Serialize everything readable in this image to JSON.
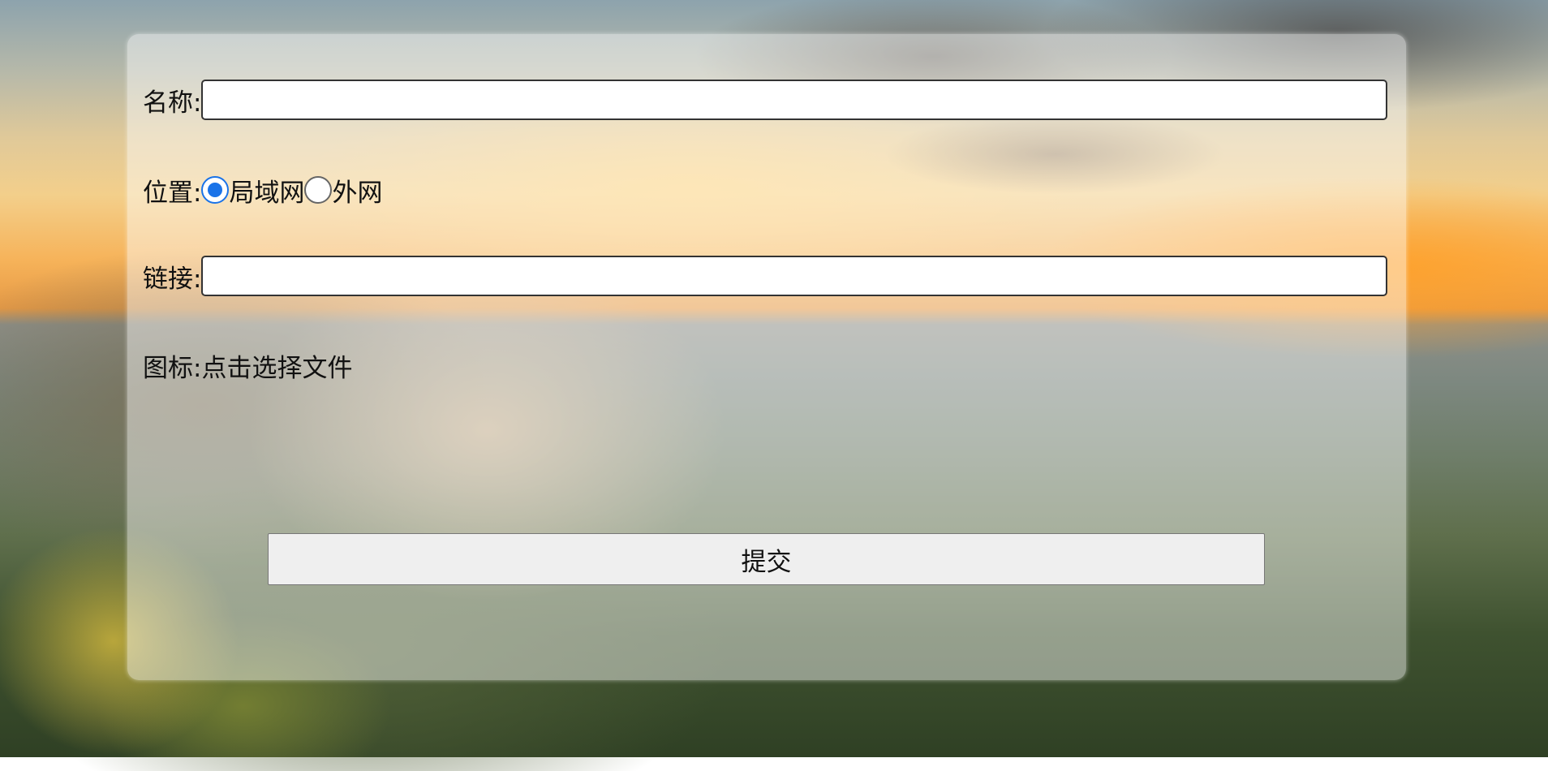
{
  "form": {
    "name_label": "名称:",
    "name_value": "",
    "location_label": "位置:",
    "location_options": [
      {
        "label": "局域网",
        "checked": true
      },
      {
        "label": "外网",
        "checked": false
      }
    ],
    "link_label": "链接:",
    "link_value": "",
    "icon_label": "图标:",
    "icon_picker_text": "点击选择文件",
    "submit_label": "提交"
  },
  "colors": {
    "radio_accent": "#1a73e8",
    "button_bg": "#efefef"
  }
}
